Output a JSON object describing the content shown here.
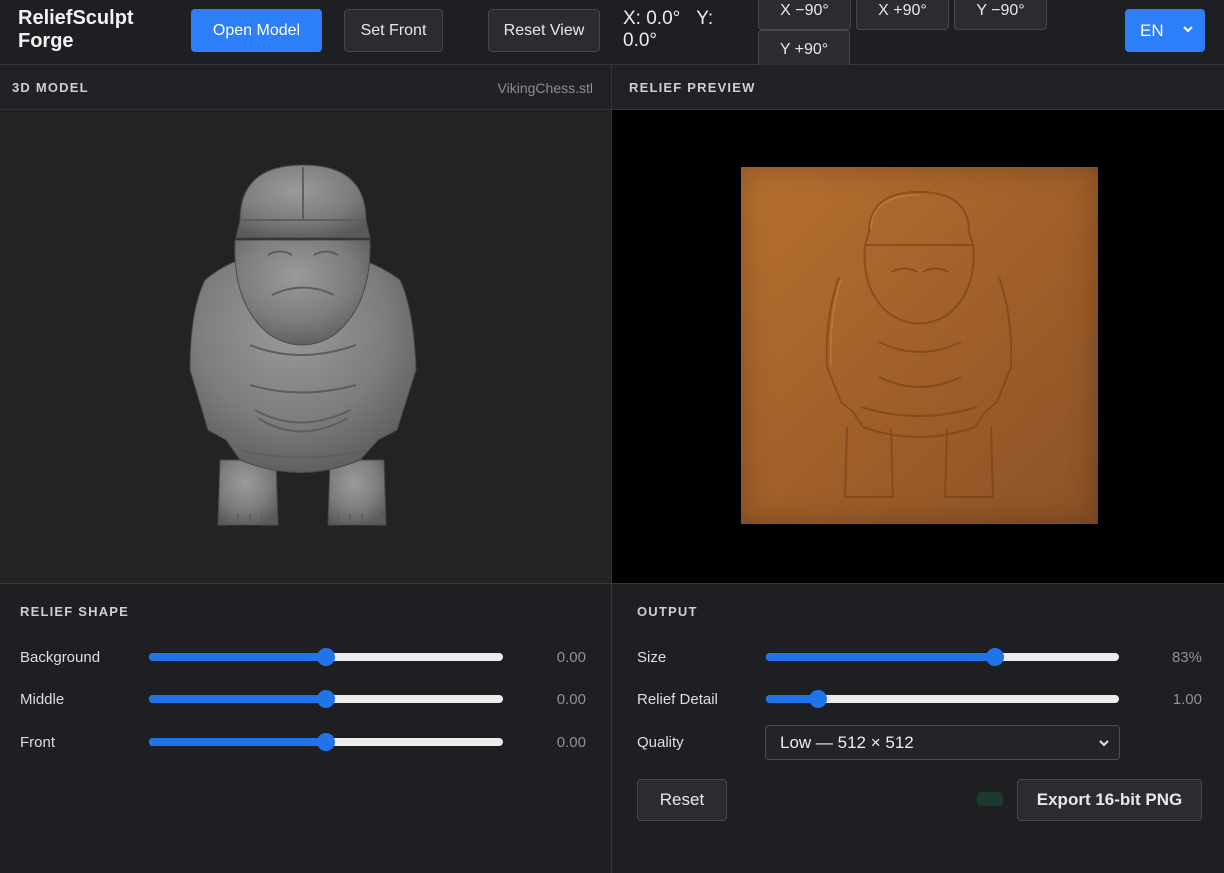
{
  "app": {
    "title": "ReliefSculpt Forge"
  },
  "toolbar": {
    "open_model": "Open Model",
    "set_front": "Set Front",
    "reset_view": "Reset View",
    "coord_x": "X: 0.0°",
    "coord_y": "Y: 0.0°",
    "rot_x_neg": "X −90°",
    "rot_x_pos": "X +90°",
    "rot_y_neg": "Y −90°",
    "rot_y_pos": "Y +90°",
    "language": "EN"
  },
  "model_panel": {
    "title": "3D MODEL",
    "filename": "VikingChess.stl"
  },
  "preview_panel": {
    "title": "RELIEF PREVIEW"
  },
  "relief_shape": {
    "title": "RELIEF SHAPE",
    "rows": [
      {
        "label": "Background",
        "value": "0.00",
        "position": 0.5
      },
      {
        "label": "Middle",
        "value": "0.00",
        "position": 0.5
      },
      {
        "label": "Front",
        "value": "0.00",
        "position": 0.5
      }
    ]
  },
  "output": {
    "title": "OUTPUT",
    "size": {
      "label": "Size",
      "value": "83%",
      "position": 0.65
    },
    "detail": {
      "label": "Relief Detail",
      "value": "1.00",
      "position": 0.147
    },
    "quality": {
      "label": "Quality",
      "selected": "Low — 512 × 512"
    },
    "reset": "Reset",
    "export": "Export 16-bit PNG"
  },
  "colors": {
    "accent": "#2d7ff9",
    "relief": "#a4612a"
  }
}
